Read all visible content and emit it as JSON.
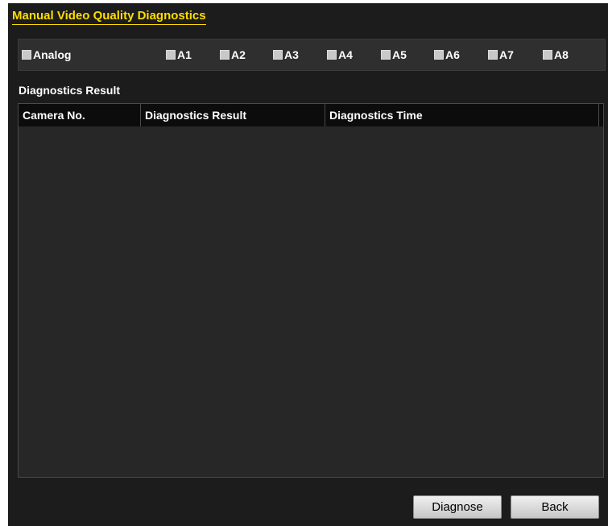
{
  "window": {
    "title": "Manual Video Quality Diagnostics"
  },
  "channels": {
    "group_label": "Analog",
    "items": [
      {
        "label": "A1",
        "checked": false
      },
      {
        "label": "A2",
        "checked": false
      },
      {
        "label": "A3",
        "checked": false
      },
      {
        "label": "A4",
        "checked": false
      },
      {
        "label": "A5",
        "checked": false
      },
      {
        "label": "A6",
        "checked": false
      },
      {
        "label": "A7",
        "checked": false
      },
      {
        "label": "A8",
        "checked": false
      }
    ]
  },
  "results": {
    "section_label": "Diagnostics Result",
    "columns": [
      "Camera No.",
      "Diagnostics Result",
      "Diagnostics Time"
    ],
    "rows": []
  },
  "buttons": {
    "diagnose": "Diagnose",
    "back": "Back"
  },
  "colors": {
    "title": "#ffdd00",
    "background": "#1c1c1c",
    "table_header": "#0c0c0c",
    "checkbox": "#c8c8c8"
  }
}
